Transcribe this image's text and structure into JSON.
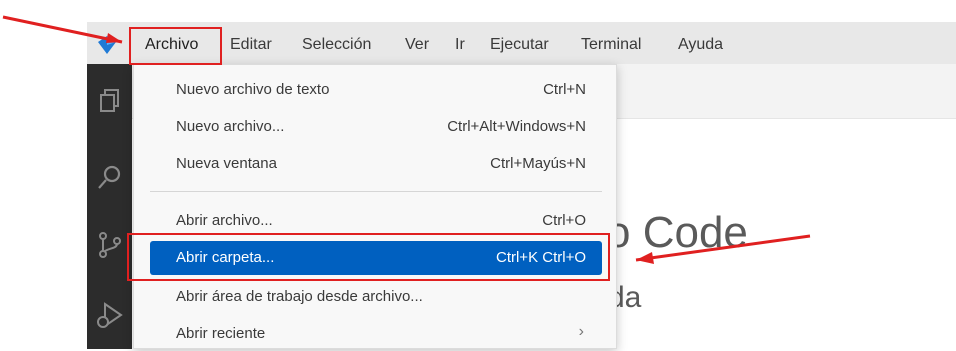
{
  "menubar": {
    "items": [
      {
        "label": "Archivo"
      },
      {
        "label": "Editar"
      },
      {
        "label": "Selección"
      },
      {
        "label": "Ver"
      },
      {
        "label": "Ir"
      },
      {
        "label": "Ejecutar"
      },
      {
        "label": "Terminal"
      },
      {
        "label": "Ayuda"
      }
    ]
  },
  "activitybar": {
    "icons": [
      "files-icon",
      "search-icon",
      "source-control-icon",
      "run-debug-icon"
    ]
  },
  "file_menu": {
    "items": [
      {
        "label": "Nuevo archivo de texto",
        "shortcut": "Ctrl+N"
      },
      {
        "label": "Nuevo archivo...",
        "shortcut": "Ctrl+Alt+Windows+N"
      },
      {
        "label": "Nueva ventana",
        "shortcut": "Ctrl+Mayús+N"
      },
      {
        "label": "Abrir archivo...",
        "shortcut": "Ctrl+O"
      },
      {
        "label": "Abrir carpeta...",
        "shortcut": "Ctrl+K Ctrl+O"
      },
      {
        "label": "Abrir área de trabajo desde archivo...",
        "shortcut": ""
      },
      {
        "label": "Abrir reciente",
        "shortcut": "",
        "submenu_glyph": "›"
      }
    ]
  },
  "welcome": {
    "title_fragment": "o Code",
    "subtitle_fragment": "da"
  },
  "colors": {
    "menubar_bg": "#e8e8e8",
    "activitybar_bg": "#2c2c2c",
    "highlight": "#0060c0",
    "annotation": "#e02020"
  }
}
